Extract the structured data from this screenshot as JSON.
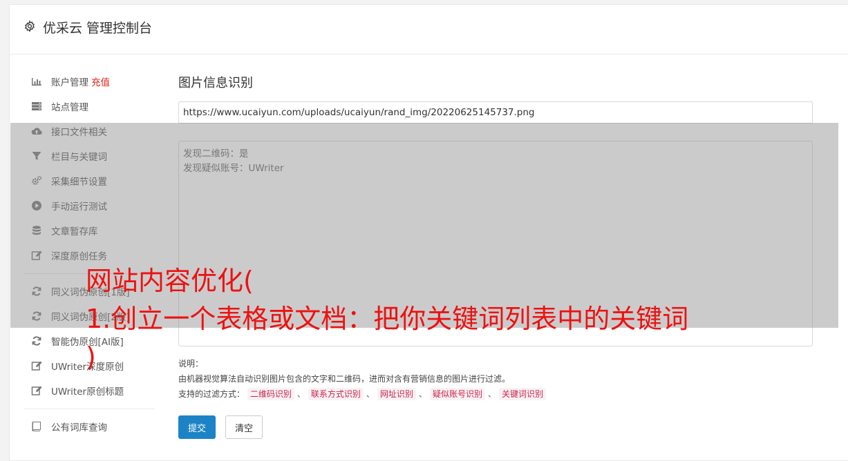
{
  "header": {
    "title": "优采云 管理控制台",
    "icon": "gear-icon"
  },
  "sidebar": {
    "items": [
      {
        "label": "账户管理",
        "badge": "充值",
        "icon": "bar-chart-icon"
      },
      {
        "label": "站点管理",
        "icon": "server-icon"
      },
      {
        "label": "接口文件相关",
        "icon": "cloud-upload-icon"
      },
      {
        "label": "栏目与关键词",
        "icon": "filter-icon"
      },
      {
        "label": "采集细节设置",
        "icon": "cogs-icon"
      },
      {
        "label": "手动运行测试",
        "icon": "play-circle-icon"
      },
      {
        "label": "文章暂存库",
        "icon": "database-icon"
      },
      {
        "label": "深度原创任务",
        "icon": "edit-icon"
      },
      {
        "label": "同义词伪原创[1版]",
        "icon": "refresh-icon"
      },
      {
        "label": "同义词伪原创[2版]",
        "icon": "refresh-icon"
      },
      {
        "label": "智能伪原创[AI版]",
        "icon": "refresh-icon"
      },
      {
        "label": "UWriter深度原创",
        "icon": "edit-icon"
      },
      {
        "label": "UWriter原创标题",
        "icon": "edit-icon"
      },
      {
        "label": "公有词库查询",
        "icon": "book-icon"
      }
    ]
  },
  "main": {
    "section_title": "图片信息识别",
    "url_value": "https://www.ucaiyun.com/uploads/ucaiyun/rand_img/20220625145737.png",
    "result_lines": [
      "发现二维码：是",
      "发现疑似账号：UWriter"
    ],
    "notes": {
      "label": "说明：",
      "description": "由机器视觉算法自动识别图片包含的文字和二维码，进而对含有营销信息的图片进行过滤。",
      "filter_label": "支持的过滤方式：",
      "filters": [
        "二维码识别",
        "联系方式识别",
        "网址识别",
        "疑似账号识别",
        "关键词识别"
      ],
      "separator": "、"
    },
    "submit_label": "提交",
    "clear_label": "清空"
  },
  "overlay": {
    "line1": "网站内容优化(",
    "line2": "1.创立一个表格或文档：把你关键词列表中的关键词",
    "line3": ")"
  },
  "colors": {
    "accent": "#1c84c6",
    "badge_red": "#e2231a",
    "overlay_text": "#ee1111"
  }
}
